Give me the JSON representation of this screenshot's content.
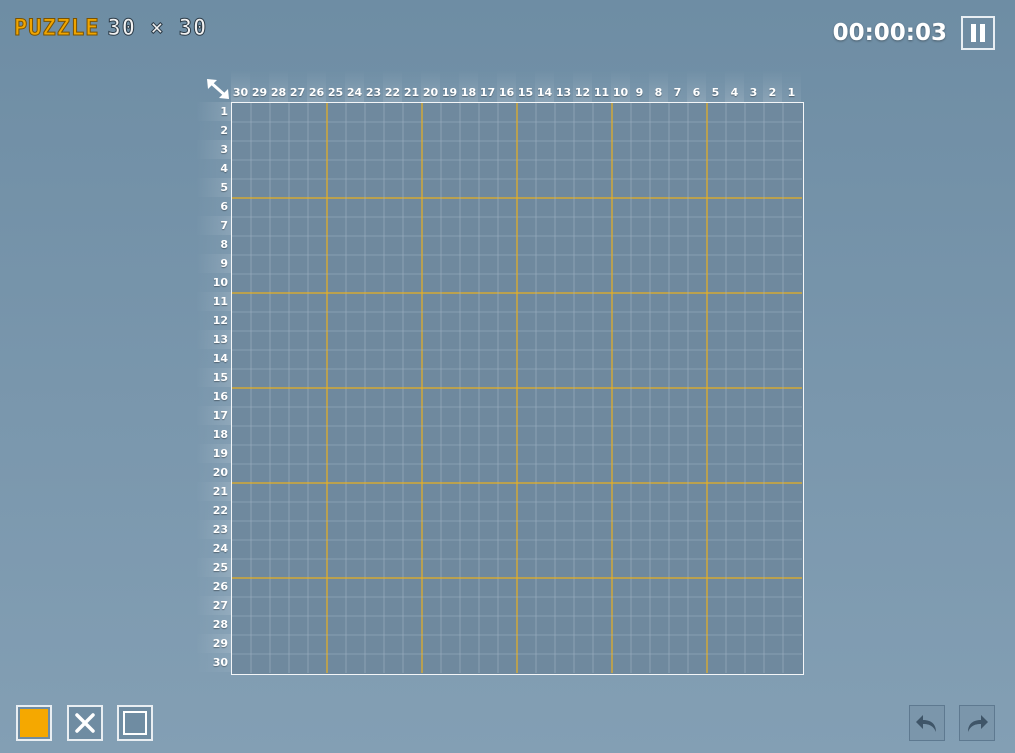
{
  "title": {
    "word": "PUZZLE",
    "size": "30 × 30"
  },
  "timer": "00:00:03",
  "grid": {
    "columns": 30,
    "rows": 30,
    "block": 5,
    "col_labels": [
      "30",
      "29",
      "28",
      "27",
      "26",
      "25",
      "24",
      "23",
      "22",
      "21",
      "20",
      "19",
      "18",
      "17",
      "16",
      "15",
      "14",
      "13",
      "12",
      "11",
      "10",
      "9",
      "8",
      "7",
      "6",
      "5",
      "4",
      "3",
      "2",
      "1"
    ],
    "row_labels": [
      "1",
      "2",
      "3",
      "4",
      "5",
      "6",
      "7",
      "8",
      "9",
      "10",
      "11",
      "12",
      "13",
      "14",
      "15",
      "16",
      "17",
      "18",
      "19",
      "20",
      "21",
      "22",
      "23",
      "24",
      "25",
      "26",
      "27",
      "28",
      "29",
      "30"
    ],
    "filled_cells": 0
  },
  "colors": {
    "accent": "#f5a800",
    "board": "#6f899e",
    "grid_line": "#9fb3c3",
    "block_line": "#e8b020"
  },
  "tools": [
    {
      "name": "fill",
      "icon": "filled-square-icon",
      "selected": true
    },
    {
      "name": "cross",
      "icon": "x-mark-icon"
    },
    {
      "name": "empty",
      "icon": "empty-square-icon"
    }
  ],
  "actions": {
    "undo_icon": "undo-arrow-icon",
    "redo_icon": "redo-arrow-icon",
    "pause_icon": "pause-icon",
    "resize_icon": "resize-diagonal-icon"
  }
}
